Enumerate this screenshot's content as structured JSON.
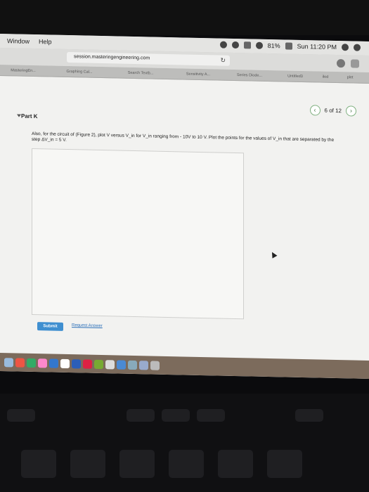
{
  "menubar": {
    "items": [
      "Window",
      "Help"
    ],
    "battery": "81%",
    "clock": "Sun 11:20 PM"
  },
  "browser": {
    "url": "session.masteringengineering.com",
    "reload_icon": "reload-icon",
    "tabs": [
      "MasteringEn...",
      "Graphing Cal...",
      "Search Textb...",
      "Sensitivity A...",
      "Series Diode...",
      "Untitled3",
      "iled",
      "plet"
    ]
  },
  "content": {
    "pager": "6 of 12",
    "part_label": "Part K",
    "question": "Also, for the circuit of (Figure 2), plot V versus V_in for V_in ranging from - 10V to 10 V. Plot the points for the values of V_in that are separated by the step ΔV_in = 5 V.",
    "submit_label": "Submit",
    "request_label": "Request Answer"
  },
  "colors": {
    "accent": "#3f8fd0",
    "link": "#2a6fb8",
    "pager_border": "#7fb07f"
  }
}
